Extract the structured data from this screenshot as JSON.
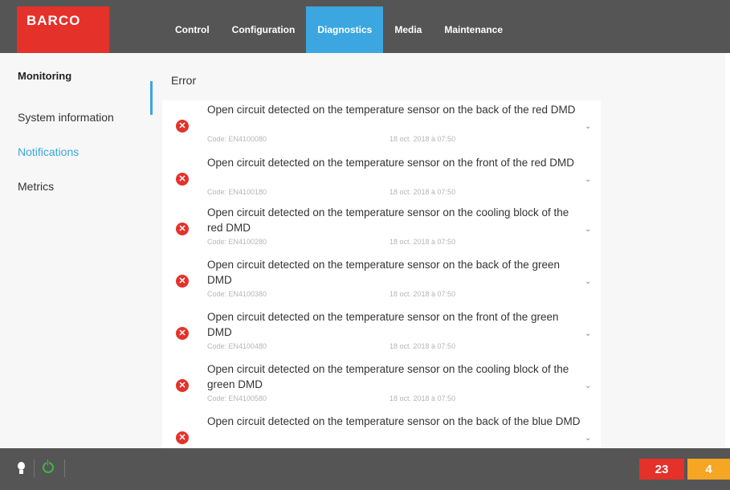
{
  "header": {
    "logo": "BARCO",
    "tabs": [
      {
        "label": "Control"
      },
      {
        "label": "Configuration"
      },
      {
        "label": "Diagnostics"
      },
      {
        "label": "Media"
      },
      {
        "label": "Maintenance"
      }
    ],
    "active_tab": "Diagnostics"
  },
  "sidebar": {
    "heading": "Monitoring",
    "items": [
      {
        "label": "System information"
      },
      {
        "label": "Notifications"
      },
      {
        "label": "Metrics"
      }
    ],
    "active_item": "Notifications"
  },
  "main": {
    "section_title": "Error",
    "notifications": [
      {
        "message": "Open circuit detected on the temperature sensor on the back of the red DMD",
        "code": "Code: EN4100080",
        "date": "18 oct. 2018 à 07:50"
      },
      {
        "message": "Open circuit detected on the temperature sensor on the front of the red DMD",
        "code": "Code: EN4100180",
        "date": "18 oct. 2018 à 07:50"
      },
      {
        "message": "Open circuit detected on the temperature sensor on the cooling block of the red DMD",
        "code": "Code: EN4100280",
        "date": "18 oct. 2018 à 07:50"
      },
      {
        "message": "Open circuit detected on the temperature sensor on the back of the green DMD",
        "code": "Code: EN4100380",
        "date": "18 oct. 2018 à 07:50"
      },
      {
        "message": "Open circuit detected on the temperature sensor on the front of the green DMD",
        "code": "Code: EN4100480",
        "date": "18 oct. 2018 à 07:50"
      },
      {
        "message": "Open circuit detected on the temperature sensor on the cooling block of the green DMD",
        "code": "Code: EN4100580",
        "date": "18 oct. 2018 à 07:50"
      },
      {
        "message": "Open circuit detected on the temperature sensor on the back of the blue DMD",
        "code": "",
        "date": ""
      }
    ]
  },
  "footer": {
    "error_count": "23",
    "warning_count": "4"
  },
  "colors": {
    "brand_red": "#e4322b",
    "accent_blue": "#3ba6e0",
    "warning_orange": "#f5a623",
    "status_green": "#3cb64a",
    "bar_gray": "#555555"
  }
}
